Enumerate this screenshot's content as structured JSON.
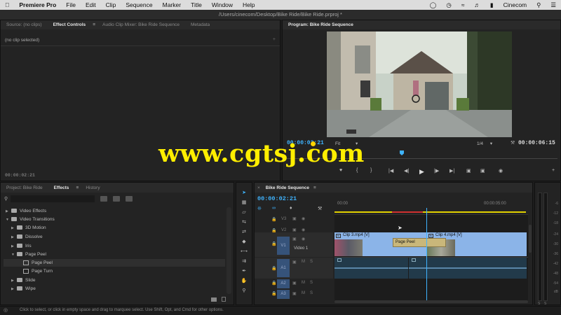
{
  "menubar": {
    "apple": "",
    "app": "Premiere Pro",
    "items": [
      "File",
      "Edit",
      "Clip",
      "Sequence",
      "Marker",
      "Title",
      "Window",
      "Help"
    ],
    "user": "Cinecom"
  },
  "titlebar": {
    "text": "/Users/cinecom/Desktop/Bike Ride/Bike Ride.prproj *"
  },
  "source_panel": {
    "tabs": [
      "Source: (no clips)",
      "Effect Controls",
      "Audio Clip Mixer: Bike Ride Sequence",
      "Metadata"
    ],
    "active": "Effect Controls",
    "empty_text": "(no clip selected)",
    "timecode": "00:00:02:21"
  },
  "program": {
    "tab": "Program: Bike Ride Sequence",
    "timecode_left": "00:00:02:21",
    "fit": "Fit",
    "fraction": "1/4",
    "timecode_right": "00:00:06:15"
  },
  "watermark": "www.cgtsj.com",
  "project_panel": {
    "tabs": [
      "Project: Bike Ride",
      "Effects",
      "History"
    ],
    "active": "Effects",
    "tree": [
      {
        "label": "Video Effects",
        "level": 0,
        "open": false,
        "type": "folder"
      },
      {
        "label": "Video Transitions",
        "level": 0,
        "open": true,
        "type": "folder"
      },
      {
        "label": "3D Motion",
        "level": 1,
        "open": false,
        "type": "folder"
      },
      {
        "label": "Dissolve",
        "level": 1,
        "open": false,
        "type": "folder"
      },
      {
        "label": "Iris",
        "level": 1,
        "open": false,
        "type": "folder"
      },
      {
        "label": "Page Peel",
        "level": 1,
        "open": true,
        "type": "folder"
      },
      {
        "label": "Page Peel",
        "level": 2,
        "type": "item",
        "selected": true
      },
      {
        "label": "Page Turn",
        "level": 2,
        "type": "item"
      },
      {
        "label": "Slide",
        "level": 1,
        "open": false,
        "type": "folder"
      },
      {
        "label": "Wipe",
        "level": 1,
        "open": false,
        "type": "folder"
      }
    ]
  },
  "timeline": {
    "tab": "Bike Ride Sequence",
    "timecode": "00:00:02:21",
    "ruler": [
      "00:00",
      "00:00:05:00"
    ],
    "tracks": [
      {
        "name": "V3",
        "label": ""
      },
      {
        "name": "V2",
        "label": ""
      },
      {
        "name": "V1",
        "label": "Video 1"
      },
      {
        "name": "A1",
        "label": ""
      },
      {
        "name": "A2",
        "label": ""
      },
      {
        "name": "A3",
        "label": ""
      }
    ],
    "clips": {
      "clip1": "Clip 3.mp4 [V]",
      "transition": "Page Peel",
      "clip2": "Clip 4.mp4 [V]"
    }
  },
  "meter": {
    "labels": [
      "-6",
      "-12",
      "-18",
      "-24",
      "-30",
      "-36",
      "-42",
      "-48",
      "-54",
      "dB"
    ]
  },
  "status": {
    "text": "Click to select, or click in empty space and drag to marquee select. Use Shift, Opt, and Cmd for other options."
  },
  "colors": {
    "accent": "#3fb4ff",
    "clip_blue": "#8bb4e8",
    "transition": "#c9b77a",
    "playhead": "#3fb4ff"
  }
}
